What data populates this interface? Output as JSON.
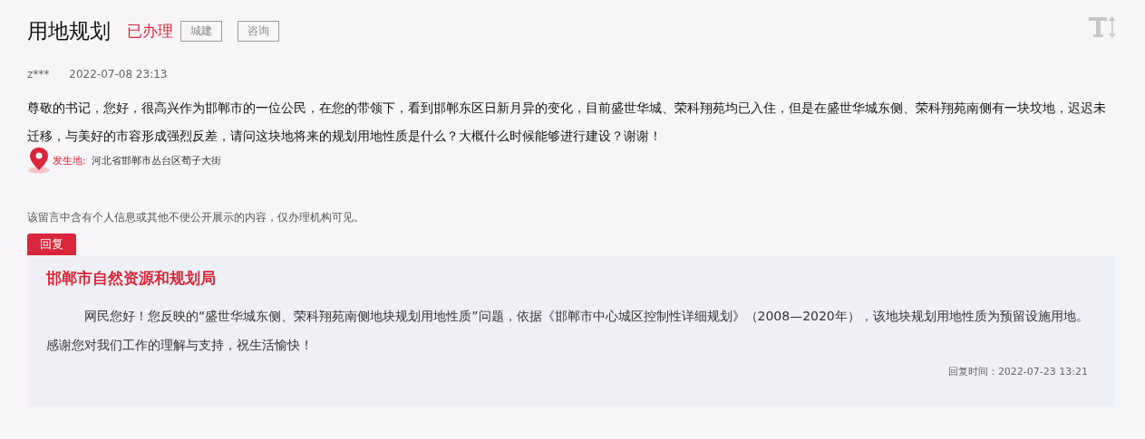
{
  "title": "用地规划",
  "status": "已办理",
  "tags": [
    "城建",
    "咨询"
  ],
  "author": "z***",
  "date": "2022-07-08 23:13",
  "content": "尊敬的书记，您好，很高兴作为邯郸市的一位公民，在您的带领下，看到邯郸东区日新月异的变化，目前盛世华城、荣科翔苑均已入住，但是在盛世华城东侧、荣科翔苑南侧有一块坟地，迟迟未迁移，与美好的市容形成强烈反差，请问这块地将来的规划用地性质是什么？大概什么时候能够进行建设？谢谢！",
  "location": {
    "label": "发生地:",
    "value": "河北省邯郸市丛台区荀子大街"
  },
  "privacy_note": "该留言中含有个人信息或其他不便公开展示的内容，仅办理机构可见。",
  "reply": {
    "tab": "回复",
    "org": "邯郸市自然资源和规划局",
    "text": "网民您好！您反映的“盛世华城东侧、荣科翔苑南侧地块规划用地性质”问题，依据《邯郸市中心城区控制性详细规划》（2008—2020年），该地块规划用地性质为预留设施用地。感谢您对我们工作的理解与支持，祝生活愉快！",
    "time": "回复时间：2022-07-23 13:21"
  }
}
